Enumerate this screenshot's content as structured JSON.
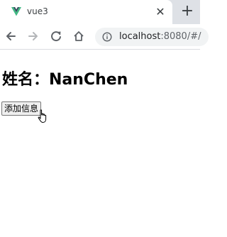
{
  "browser": {
    "tab_title": "vue3",
    "tab_close_icon": "close-icon",
    "new_tab_icon": "plus-icon",
    "url_host": "localhost",
    "url_rest": ":8080/#/",
    "accent_color": "#41b883"
  },
  "page": {
    "heading": "姓名：NanChen",
    "add_button_label": "添加信息"
  }
}
